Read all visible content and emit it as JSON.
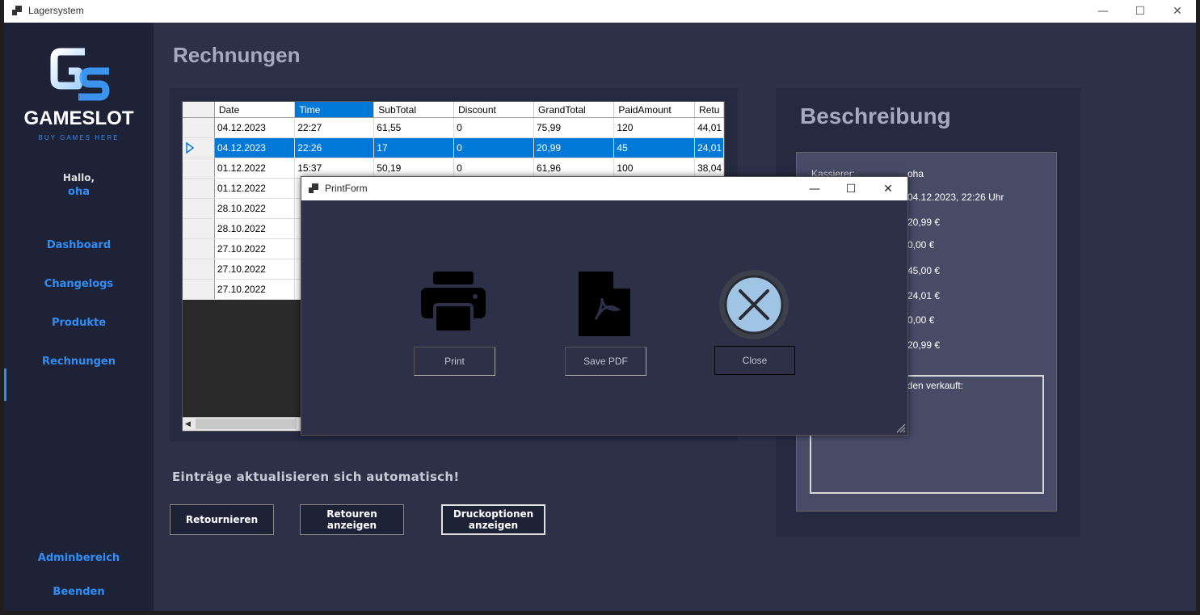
{
  "window": {
    "title": "Lagersystem",
    "minimize_glyph": "—",
    "maximize_glyph": "☐",
    "close_glyph": "✕"
  },
  "sidebar": {
    "logo_text": "GAMESLOT",
    "logo_tagline": "BUY GAMES HERE",
    "greeting": "Hallo,",
    "username": "oha",
    "nav": [
      {
        "label": "Dashboard"
      },
      {
        "label": "Changelogs"
      },
      {
        "label": "Produkte"
      },
      {
        "label": "Rechnungen",
        "active": true
      }
    ],
    "admin_label": "Adminbereich",
    "exit_label": "Beenden"
  },
  "main": {
    "title": "Rechnungen",
    "grid": {
      "columns": [
        "Date",
        "Time",
        "SubTotal",
        "Discount",
        "GrandTotal",
        "PaidAmount",
        "Retu"
      ],
      "selected_column": "Time",
      "rows": [
        [
          "04.12.2023",
          "22:27",
          "61,55",
          "0",
          "75,99",
          "120",
          "44,01"
        ],
        [
          "04.12.2023",
          "22:26",
          "17",
          "0",
          "20,99",
          "45",
          "24,01"
        ],
        [
          "01.12.2022",
          "15:37",
          "50,19",
          "0",
          "61,96",
          "100",
          "38,04"
        ],
        [
          "01.12.2022",
          "",
          "",
          "",
          "",
          "",
          ""
        ],
        [
          "28.10.2022",
          "",
          "",
          "",
          "",
          "",
          ""
        ],
        [
          "28.10.2022",
          "",
          "",
          "",
          "",
          "",
          ""
        ],
        [
          "27.10.2022",
          "",
          "",
          "",
          "",
          "",
          ""
        ],
        [
          "27.10.2022",
          "",
          "",
          "",
          "",
          "",
          ""
        ],
        [
          "27.10.2022",
          "",
          "",
          "",
          "",
          "",
          ""
        ]
      ],
      "selected_row": 1
    },
    "auto_update_text": "Einträge aktualisieren sich automatisch!",
    "buttons": {
      "return": "Retournieren",
      "show_returns": "Retouren anzeigen",
      "print_options": "Druckoptionen anzeigen"
    }
  },
  "description": {
    "title": "Beschreibung",
    "cashier_label": "Kassierer:",
    "cashier_value": "oha",
    "values": [
      "04.12.2023, 22:26 Uhr",
      "20,99 €",
      "0,00 €",
      "45,00 €",
      "24,01 €",
      "0,00 €",
      "20,99 €"
    ],
    "sold_text": "urden verkauft:"
  },
  "dialog": {
    "title": "PrintForm",
    "print_label": "Print",
    "save_pdf_label": "Save PDF",
    "close_label": "Close"
  },
  "colors": {
    "accent": "#2f8df4",
    "background": "#2d3047",
    "sidebar": "#1e2237",
    "selection": "#0078d7"
  }
}
